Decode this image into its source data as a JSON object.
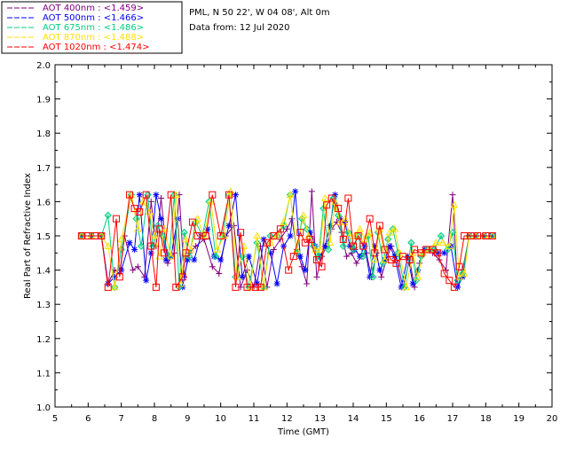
{
  "header": {
    "site_line": "PML, N 50 22', W 04 08', Alt 0m",
    "date_line": "Data from: 12 Jul 2020"
  },
  "legend": [
    {
      "label": "AOT  400nm : <1.459>",
      "color": "#800080"
    },
    {
      "label": "AOT  500nm : <1.466>",
      "color": "#0000ff"
    },
    {
      "label": "AOT  675nm : <1.486>",
      "color": "#00d080"
    },
    {
      "label": "AOT  870nm : <1.488>",
      "color": "#ffe000"
    },
    {
      "label": "AOT 1020nm : <1.474>",
      "color": "#ff0000"
    }
  ],
  "chart_data": {
    "type": "line",
    "xlabel": "Time (GMT)",
    "ylabel": "Real Part of Refractive Index",
    "xlim": [
      5,
      20
    ],
    "ylim": [
      1.0,
      2.0
    ],
    "xticks": [
      "5",
      "6",
      "7",
      "8",
      "9",
      "10",
      "11",
      "12",
      "13",
      "14",
      "15",
      "16",
      "17",
      "18",
      "19",
      "20"
    ],
    "yticks": [
      "1.0",
      "1.1",
      "1.2",
      "1.3",
      "1.4",
      "1.5",
      "1.6",
      "1.7",
      "1.8",
      "1.9",
      "2.0"
    ],
    "series": [
      {
        "name": "AOT  400nm : <1.459>",
        "color": "#800080",
        "marker": "plus",
        "x": [
          5.8,
          6.1,
          6.4,
          6.6,
          6.8,
          6.95,
          7.1,
          7.35,
          7.5,
          7.7,
          7.9,
          8.05,
          8.2,
          8.4,
          8.6,
          8.75,
          8.9,
          9.05,
          9.25,
          9.5,
          9.75,
          9.95,
          10.15,
          10.4,
          10.6,
          10.8,
          11.0,
          11.2,
          11.4,
          11.6,
          11.8,
          12.0,
          12.15,
          12.3,
          12.45,
          12.6,
          12.75,
          12.9,
          13.05,
          13.2,
          13.35,
          13.5,
          13.65,
          13.8,
          13.95,
          14.1,
          14.25,
          14.4,
          14.55,
          14.7,
          14.85,
          15.0,
          15.15,
          15.3,
          15.5,
          15.7,
          15.85,
          16.0,
          16.2,
          16.4,
          16.6,
          16.8,
          17.0,
          17.15,
          17.3,
          17.5,
          17.7,
          17.95,
          18.2
        ],
        "y": [
          1.5,
          1.5,
          1.5,
          1.36,
          1.4,
          1.39,
          1.5,
          1.4,
          1.41,
          1.38,
          1.6,
          1.47,
          1.61,
          1.42,
          1.45,
          1.62,
          1.38,
          1.45,
          1.47,
          1.49,
          1.41,
          1.39,
          1.5,
          1.53,
          1.35,
          1.4,
          1.35,
          1.47,
          1.35,
          1.46,
          1.49,
          1.52,
          1.55,
          1.46,
          1.41,
          1.36,
          1.63,
          1.38,
          1.44,
          1.47,
          1.52,
          1.54,
          1.51,
          1.44,
          1.45,
          1.42,
          1.44,
          1.45,
          1.38,
          1.45,
          1.38,
          1.43,
          1.47,
          1.44,
          1.35,
          1.43,
          1.35,
          1.42,
          1.46,
          1.45,
          1.43,
          1.4,
          1.62,
          1.35,
          1.4,
          1.5,
          1.5,
          1.5,
          1.5
        ]
      },
      {
        "name": "AOT  500nm : <1.466>",
        "color": "#0000ff",
        "marker": "asterisk",
        "x": [
          5.8,
          6.1,
          6.4,
          6.6,
          6.8,
          7.0,
          7.25,
          7.4,
          7.55,
          7.75,
          7.9,
          8.05,
          8.2,
          8.35,
          8.5,
          8.7,
          8.85,
          9.0,
          9.2,
          9.4,
          9.6,
          9.8,
          10.0,
          10.25,
          10.45,
          10.65,
          10.85,
          11.1,
          11.3,
          11.5,
          11.7,
          11.9,
          12.1,
          12.25,
          12.4,
          12.55,
          12.7,
          12.85,
          13.0,
          13.15,
          13.3,
          13.45,
          13.6,
          13.75,
          13.9,
          14.05,
          14.2,
          14.35,
          14.5,
          14.65,
          14.8,
          14.95,
          15.1,
          15.25,
          15.45,
          15.65,
          15.8,
          15.95,
          16.15,
          16.35,
          16.55,
          16.75,
          16.95,
          17.15,
          17.3,
          17.5,
          17.7,
          17.95,
          18.2
        ],
        "y": [
          1.5,
          1.5,
          1.5,
          1.36,
          1.38,
          1.4,
          1.48,
          1.46,
          1.62,
          1.37,
          1.45,
          1.62,
          1.55,
          1.43,
          1.44,
          1.55,
          1.35,
          1.43,
          1.43,
          1.5,
          1.52,
          1.44,
          1.43,
          1.53,
          1.62,
          1.38,
          1.44,
          1.36,
          1.49,
          1.45,
          1.36,
          1.47,
          1.5,
          1.63,
          1.44,
          1.4,
          1.51,
          1.47,
          1.44,
          1.47,
          1.53,
          1.62,
          1.55,
          1.54,
          1.47,
          1.46,
          1.44,
          1.47,
          1.38,
          1.47,
          1.4,
          1.43,
          1.47,
          1.44,
          1.35,
          1.44,
          1.36,
          1.4,
          1.46,
          1.46,
          1.45,
          1.45,
          1.47,
          1.35,
          1.38,
          1.5,
          1.5,
          1.5,
          1.5
        ]
      },
      {
        "name": "AOT  675nm : <1.486>",
        "color": "#00d080",
        "marker": "diamond",
        "x": [
          5.8,
          6.1,
          6.4,
          6.6,
          6.8,
          7.0,
          7.3,
          7.45,
          7.6,
          7.8,
          7.95,
          8.1,
          8.25,
          8.45,
          8.6,
          8.75,
          8.9,
          9.05,
          9.25,
          9.45,
          9.65,
          9.85,
          10.05,
          10.25,
          10.45,
          10.65,
          10.85,
          11.1,
          11.3,
          11.5,
          11.7,
          11.9,
          12.1,
          12.3,
          12.45,
          12.6,
          12.8,
          12.95,
          13.1,
          13.25,
          13.4,
          13.55,
          13.7,
          13.85,
          14.0,
          14.15,
          14.3,
          14.45,
          14.6,
          14.75,
          14.9,
          15.05,
          15.2,
          15.35,
          15.55,
          15.75,
          15.9,
          16.05,
          16.25,
          16.45,
          16.65,
          16.85,
          17.0,
          17.15,
          17.3,
          17.5,
          17.7,
          17.95,
          18.2
        ],
        "y": [
          1.5,
          1.5,
          1.5,
          1.56,
          1.35,
          1.46,
          1.62,
          1.55,
          1.47,
          1.62,
          1.47,
          1.53,
          1.5,
          1.44,
          1.62,
          1.35,
          1.51,
          1.44,
          1.54,
          1.5,
          1.6,
          1.44,
          1.5,
          1.62,
          1.38,
          1.44,
          1.35,
          1.48,
          1.35,
          1.5,
          1.5,
          1.53,
          1.62,
          1.45,
          1.55,
          1.52,
          1.47,
          1.44,
          1.58,
          1.46,
          1.61,
          1.56,
          1.47,
          1.51,
          1.46,
          1.5,
          1.44,
          1.5,
          1.38,
          1.51,
          1.42,
          1.49,
          1.52,
          1.45,
          1.35,
          1.48,
          1.37,
          1.44,
          1.46,
          1.46,
          1.5,
          1.46,
          1.51,
          1.37,
          1.39,
          1.5,
          1.5,
          1.5,
          1.5
        ]
      },
      {
        "name": "AOT  870nm : <1.488>",
        "color": "#ffe000",
        "marker": "triangle",
        "x": [
          5.8,
          6.1,
          6.4,
          6.6,
          6.8,
          7.0,
          7.3,
          7.5,
          7.65,
          7.85,
          8.0,
          8.15,
          8.3,
          8.5,
          8.65,
          8.8,
          8.95,
          9.1,
          9.3,
          9.5,
          9.7,
          9.9,
          10.1,
          10.3,
          10.5,
          10.7,
          10.9,
          11.1,
          11.3,
          11.5,
          11.7,
          11.9,
          12.1,
          12.3,
          12.5,
          12.65,
          12.85,
          13.0,
          13.15,
          13.3,
          13.45,
          13.6,
          13.75,
          13.9,
          14.05,
          14.2,
          14.35,
          14.5,
          14.65,
          14.8,
          14.95,
          15.1,
          15.25,
          15.4,
          15.6,
          15.8,
          15.95,
          16.1,
          16.3,
          16.5,
          16.7,
          16.9,
          17.05,
          17.2,
          17.35,
          17.5,
          17.7,
          17.95,
          18.2
        ],
        "y": [
          1.5,
          1.5,
          1.5,
          1.47,
          1.35,
          1.49,
          1.62,
          1.52,
          1.6,
          1.57,
          1.5,
          1.44,
          1.52,
          1.44,
          1.62,
          1.36,
          1.49,
          1.46,
          1.55,
          1.5,
          1.6,
          1.46,
          1.5,
          1.63,
          1.38,
          1.47,
          1.35,
          1.5,
          1.35,
          1.48,
          1.5,
          1.54,
          1.62,
          1.46,
          1.56,
          1.5,
          1.46,
          1.46,
          1.61,
          1.48,
          1.6,
          1.54,
          1.55,
          1.5,
          1.5,
          1.52,
          1.49,
          1.51,
          1.43,
          1.52,
          1.43,
          1.51,
          1.52,
          1.45,
          1.35,
          1.45,
          1.38,
          1.45,
          1.46,
          1.48,
          1.48,
          1.47,
          1.59,
          1.38,
          1.39,
          1.5,
          1.5,
          1.5,
          1.5
        ]
      },
      {
        "name": "AOT 1020nm : <1.474>",
        "color": "#ff0000",
        "marker": "square",
        "x": [
          5.8,
          6.0,
          6.2,
          6.4,
          6.6,
          6.85,
          6.95,
          7.25,
          7.4,
          7.55,
          7.75,
          7.9,
          8.05,
          8.15,
          8.3,
          8.5,
          8.65,
          8.85,
          8.95,
          9.15,
          9.3,
          9.55,
          9.75,
          10.0,
          10.25,
          10.45,
          10.6,
          10.8,
          11.05,
          11.2,
          11.4,
          11.6,
          11.8,
          12.05,
          12.2,
          12.4,
          12.55,
          12.7,
          12.9,
          13.05,
          13.2,
          13.35,
          13.55,
          13.7,
          13.85,
          14.0,
          14.15,
          14.3,
          14.5,
          14.65,
          14.8,
          14.95,
          15.15,
          15.3,
          15.5,
          15.7,
          15.85,
          16.05,
          16.2,
          16.4,
          16.55,
          16.75,
          16.9,
          17.05,
          17.2,
          17.35,
          17.55,
          17.75,
          18.0,
          18.2
        ],
        "y": [
          1.5,
          1.5,
          1.5,
          1.5,
          1.35,
          1.55,
          1.38,
          1.62,
          1.58,
          1.57,
          1.62,
          1.47,
          1.35,
          1.52,
          1.45,
          1.62,
          1.35,
          1.38,
          1.45,
          1.54,
          1.5,
          1.5,
          1.62,
          1.5,
          1.62,
          1.35,
          1.51,
          1.35,
          1.35,
          1.35,
          1.48,
          1.5,
          1.52,
          1.4,
          1.44,
          1.51,
          1.48,
          1.49,
          1.43,
          1.41,
          1.59,
          1.61,
          1.58,
          1.49,
          1.61,
          1.47,
          1.5,
          1.47,
          1.55,
          1.45,
          1.53,
          1.46,
          1.43,
          1.42,
          1.44,
          1.43,
          1.46,
          1.45,
          1.46,
          1.46,
          1.45,
          1.39,
          1.37,
          1.35,
          1.41,
          1.5,
          1.5,
          1.5,
          1.5,
          1.5
        ]
      }
    ]
  }
}
